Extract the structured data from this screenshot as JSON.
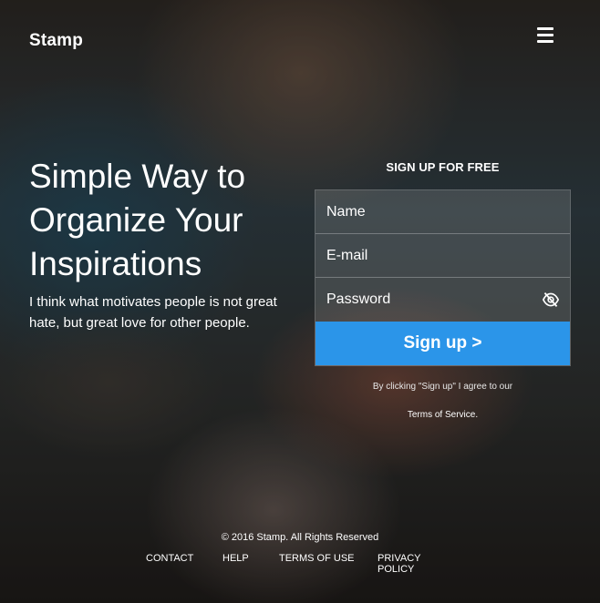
{
  "brand": {
    "logo": "Stamp"
  },
  "header": {
    "menu_icon": "hamburger-menu-icon"
  },
  "hero": {
    "title": "Simple Way to Organize Your Inspirations",
    "subtitle": "I think what motivates people is not great hate, but great love for other people."
  },
  "signup": {
    "heading": "SIGN UP FOR FREE",
    "name_placeholder": "Name",
    "email_placeholder": "E-mail",
    "password_placeholder": "Password",
    "password_toggle_icon": "eye-slash-icon",
    "button_label": "Sign up >",
    "agree_text": "By clicking \"Sign up\" I agree to our",
    "terms_link": "Terms of Service.",
    "accent_color": "#2b95e9"
  },
  "footer": {
    "copyright": "© 2016 Stamp. All Rights Reserved",
    "links": [
      "CONTACT",
      "HELP",
      "TERMS OF USE",
      "PRIVACY POLICY"
    ]
  }
}
